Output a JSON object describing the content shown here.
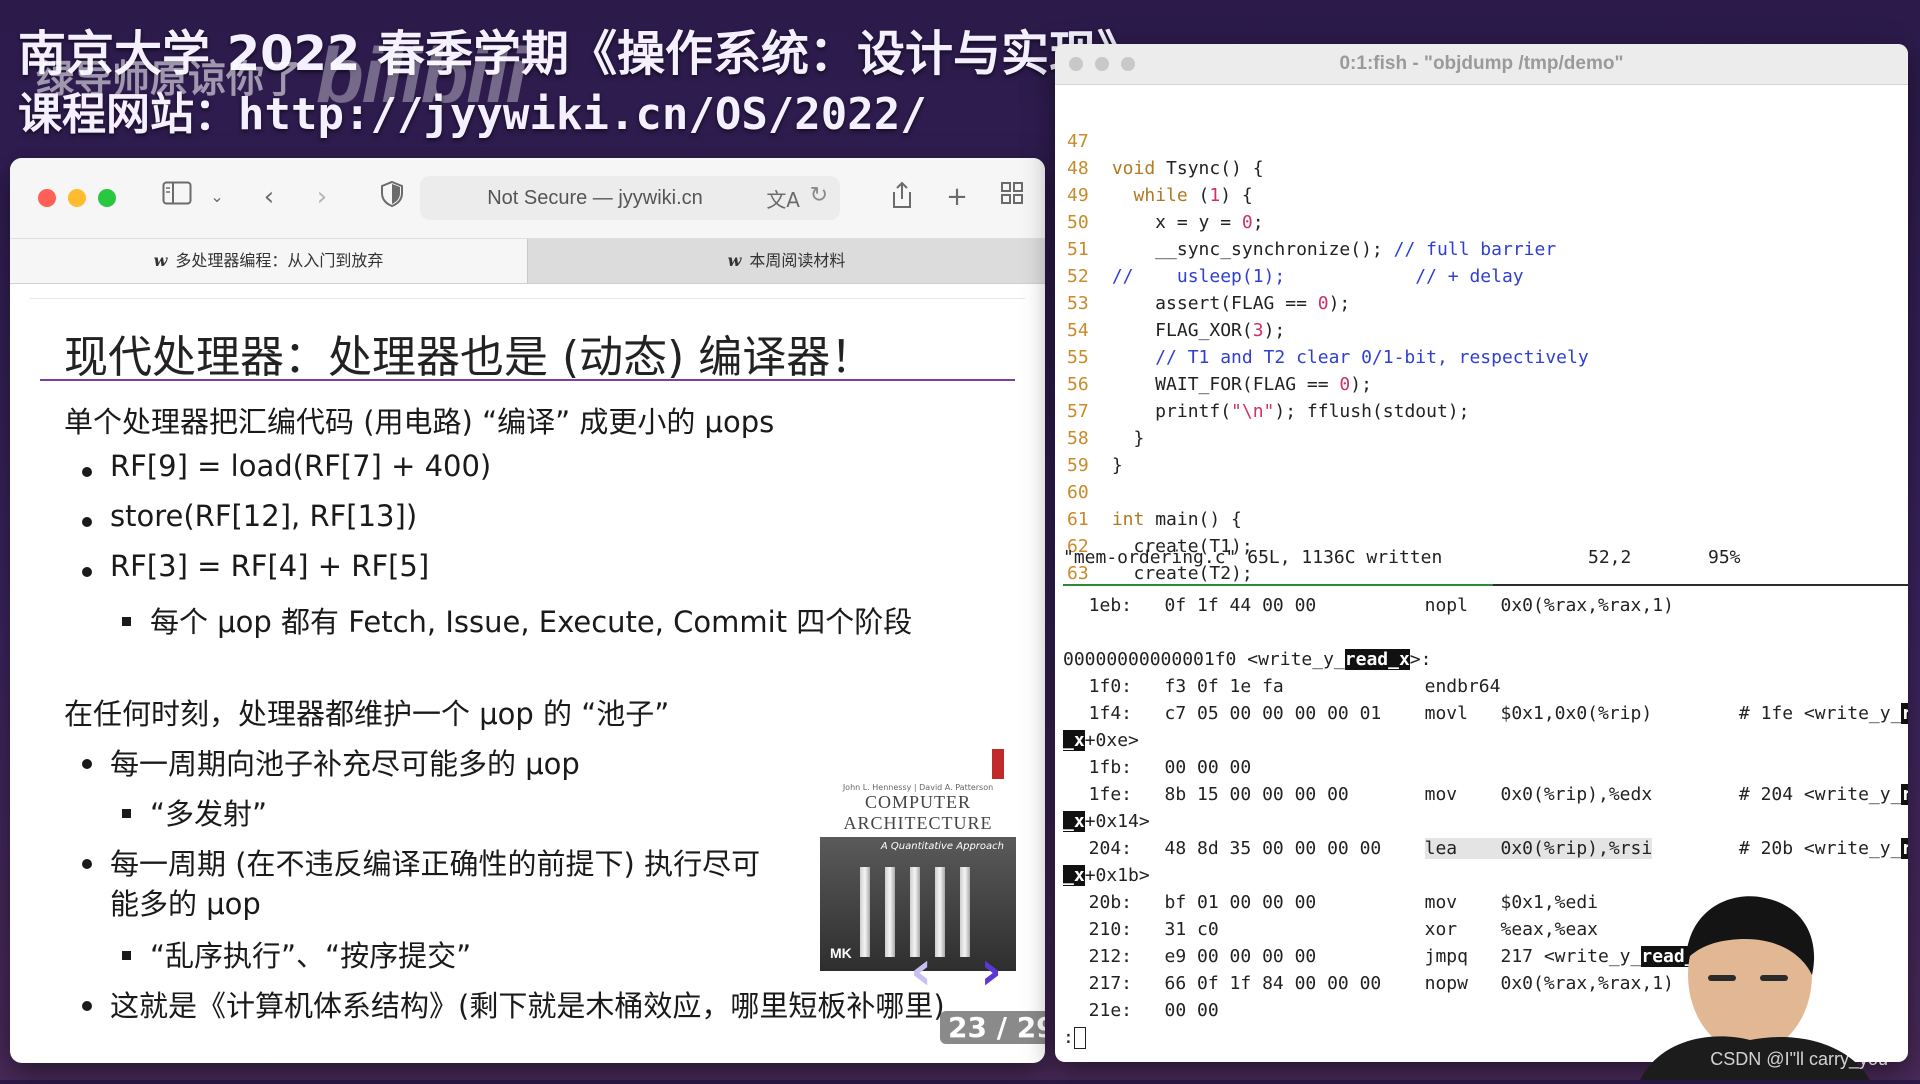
{
  "overlay": {
    "title": "南京大学 2022 春季学期《操作系统：设计与实现》",
    "subtitle_prefix": "课程网站：",
    "subtitle_url": "http://jyywiki.cn/OS/2022/",
    "danmaku": "绿导师原谅你了",
    "logo": "bilibili",
    "watermark": "CSDN @I\"ll  carry_you"
  },
  "browser": {
    "address": "Not Secure — jyywiki.cn",
    "tabs": [
      {
        "label": "多处理器编程：从入门到放弃",
        "active": true
      },
      {
        "label": "本周阅读材料",
        "active": false
      }
    ],
    "icons": [
      "sidebar-icon",
      "chevron-down-icon",
      "back-icon",
      "forward-icon",
      "shield-icon",
      "translate-icon",
      "reload-icon",
      "share-icon",
      "plus-icon",
      "grid-icon"
    ]
  },
  "slide": {
    "title": "现代处理器：处理器也是 (动态) 编译器！",
    "intro": "单个处理器把汇编代码 (用电路) “编译” 成更小的 μops",
    "bullets1": [
      "RF[9] = load(RF[7] + 400)",
      "store(RF[12], RF[13])",
      "RF[3] = RF[4] + RF[5]"
    ],
    "sub1": "每个 μop 都有 Fetch, Issue, Execute, Commit 四个阶段",
    "para2": "在任何时刻，处理器都维护一个 μop 的 “池子”",
    "b2": "每一周期向池子补充尽可能多的 μop",
    "b2sub": "“多发射”",
    "b3_line1": "每一周期 (在不违反编译正确性的前提下) 执行尽可",
    "b3_line2": "能多的 μop",
    "b3sub": "“乱序执行”、“按序提交”",
    "b4": "这就是《计算机体系结构》(剩下就是木桶效应，哪里短板补哪里)",
    "page_counter": "23 / 29",
    "book": {
      "authors": "John L. Hennessy | David A. Patterson",
      "title_line1": "COMPUTER",
      "title_line2": "ARCHITECTURE",
      "subtitle": "A Quantitative Approach",
      "publisher": "MK"
    }
  },
  "terminal": {
    "title": "0:1:fish - \"objdump /tmp/demo\"",
    "status_file": "\"mem-ordering.c\" 65L, 1136C written",
    "status_pos": "52,2",
    "status_pct": "95%",
    "prompt": ":"
  }
}
